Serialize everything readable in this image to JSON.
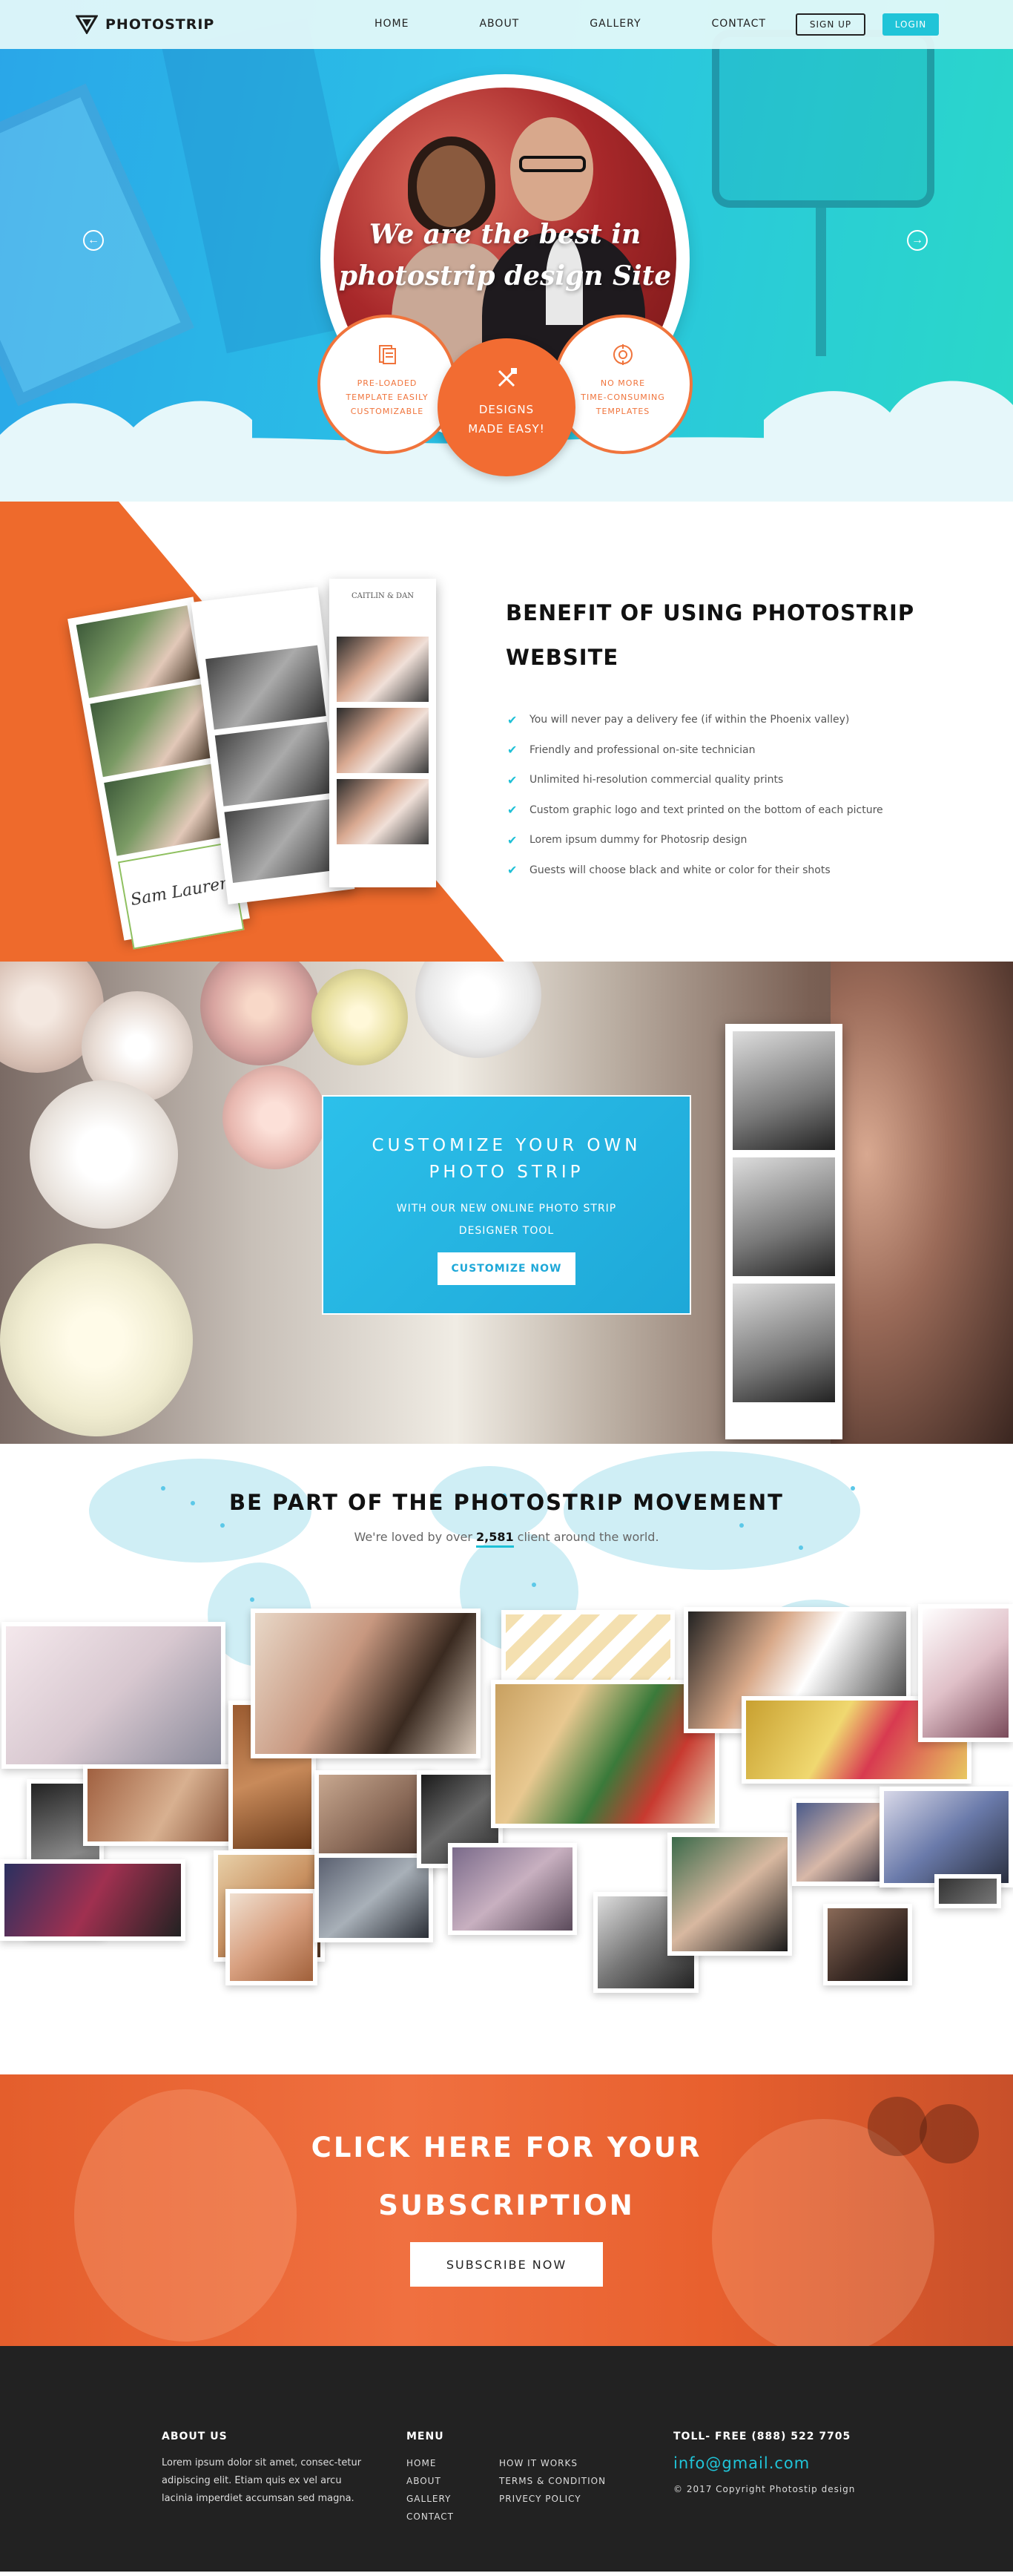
{
  "nav": {
    "brand": "PHOTOSTRIP",
    "links": [
      "HOME",
      "ABOUT",
      "GALLERY",
      "CONTACT"
    ],
    "signup_label": "SIGN UP",
    "login_label": "LOGIN"
  },
  "hero": {
    "title_line1": "We are the best in",
    "title_line2": "photostrip design Site",
    "features": [
      {
        "line1": "PRE-LOADED",
        "line2": "TEMPLATE EASILY",
        "line3": "CUSTOMIZABLE"
      },
      {
        "line1": "DESIGNS",
        "line2": "MADE EASY!"
      },
      {
        "line1": "NO MORE",
        "line2": "TIME-CONSUMING",
        "line3": "TEMPLATES"
      }
    ],
    "arrow_left": "←",
    "arrow_right": "→"
  },
  "benefits": {
    "title_line1": "BENEFIT OF USING PHOTOSTRIP",
    "title_line2": "WEBSITE",
    "items": [
      "You will never pay a delivery fee (if within the Phoenix valley)",
      "Friendly and professional on-site technician",
      "Unlimited hi-resolution commercial quality prints",
      "Custom graphic logo and text printed on the bottom of each picture",
      "Lorem ipsum dummy for Photosrip design",
      "Guests will choose black and white or color for their shots"
    ],
    "strip_signature": "Sam Lauren",
    "strip_top_text": "CAITLIN & DAN"
  },
  "customize": {
    "title_line1": "CUSTOMIZE YOUR OWN",
    "title_line2": "PHOTO STRIP",
    "sub_line1": "WITH OUR NEW ONLINE PHOTO STRIP",
    "sub_line2": "DESIGNER TOOL",
    "button_label": "CUSTOMIZE NOW"
  },
  "movement": {
    "title": "BE PART OF THE PHOTOSTRIP MOVEMENT",
    "sub_before": "We're loved by over ",
    "count": "2,581",
    "sub_after": " client around the world."
  },
  "subscribe": {
    "title_line1": "CLICK HERE FOR YOUR",
    "title_line2": "SUBSCRIPTION",
    "button_label": "SUBSCRIBE NOW"
  },
  "footer": {
    "about_heading": "ABOUT US",
    "about_text": "Lorem ipsum dolor sit amet, consec-tetur adipiscing elit. Etiam quis ex vel arcu lacinia imperdiet accumsan sed magna.",
    "menu_heading": "MENU",
    "menu_col1": [
      "HOME",
      "ABOUT",
      "GALLERY",
      "CONTACT"
    ],
    "menu_col2": [
      "HOW IT WORKS",
      "TERMS & CONDITION",
      "PRIVECY POLICY"
    ],
    "phone": "TOLL- FREE (888) 522 7705",
    "email": "info@gmail.com",
    "copyright": "© 2017 Copyright Photostip design"
  },
  "colors": {
    "accent_orange": "#f26c32",
    "accent_cyan": "#20c4d8",
    "footer_bg": "#222222"
  }
}
